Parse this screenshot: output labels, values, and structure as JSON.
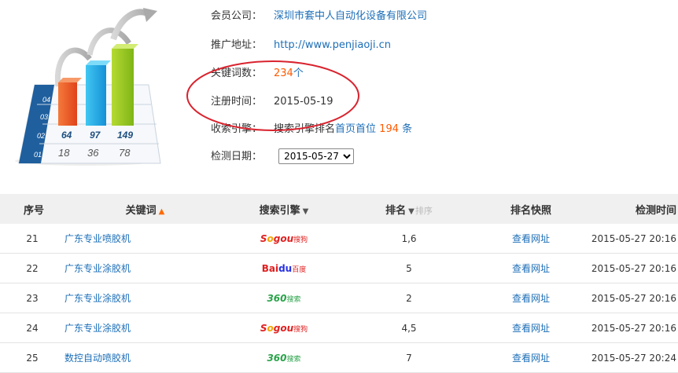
{
  "colors": {
    "link": "#1d6fb8",
    "accent": "#ff5a00",
    "ellipse": "#d9232e",
    "header_bg": "#f0f0f0"
  },
  "chart_graphic": {
    "rows_labels": [
      "04",
      "03",
      "02",
      "01"
    ],
    "top_values": [
      "64",
      "97",
      "149"
    ],
    "bottom_values": [
      "18",
      "36",
      "78"
    ]
  },
  "info": {
    "company_label": "会员公司：",
    "company_value": "深圳市套中人自动化设备有限公司",
    "url_label": "推广地址：",
    "url_value": "http://www.penjiaoji.cn",
    "keyword_count_label": "关键词数：",
    "keyword_count_value": "234",
    "keyword_count_unit": "个",
    "reg_label": "注册时间：",
    "reg_value": "2015-05-19",
    "engine_label": "收索引擎：",
    "engine_text": "搜索引擎排名",
    "engine_link": "首页首位",
    "engine_count": "194",
    "engine_unit": "条",
    "date_label": "检测日期：",
    "date_selected": "2015-05-27"
  },
  "table": {
    "headers": {
      "index": "序号",
      "keyword": "关键词",
      "engine": "搜索引擎",
      "rank": "排名",
      "rank_sort": "排序",
      "snapshot": "排名快照",
      "time": "检测时间"
    },
    "rows": [
      {
        "index": "21",
        "keyword": "广东专业喷胶机",
        "engine": "sogou",
        "engine_text": "S",
        "engine_text2": "gou",
        "engine_cn": "搜狗",
        "rank": "1,6",
        "snapshot": "查看网址",
        "time": "2015-05-27 20:16"
      },
      {
        "index": "22",
        "keyword": "广东专业涂胶机",
        "engine": "baidu",
        "engine_text": "Bai",
        "engine_text2": "du",
        "engine_cn": "百度",
        "rank": "5",
        "snapshot": "查看网址",
        "time": "2015-05-27 20:16"
      },
      {
        "index": "23",
        "keyword": "广东专业涂胶机",
        "engine": "360",
        "engine_text": "360",
        "engine_text2": "",
        "engine_cn": "搜索",
        "rank": "2",
        "snapshot": "查看网址",
        "time": "2015-05-27 20:16"
      },
      {
        "index": "24",
        "keyword": "广东专业涂胶机",
        "engine": "sogou",
        "engine_text": "S",
        "engine_text2": "gou",
        "engine_cn": "搜狗",
        "rank": "4,5",
        "snapshot": "查看网址",
        "time": "2015-05-27 20:16"
      },
      {
        "index": "25",
        "keyword": "数控自动喷胶机",
        "engine": "360",
        "engine_text": "360",
        "engine_text2": "",
        "engine_cn": "搜索",
        "rank": "7",
        "snapshot": "查看网址",
        "time": "2015-05-27 20:24"
      }
    ]
  }
}
